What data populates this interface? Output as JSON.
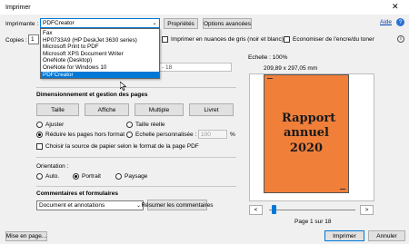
{
  "window": {
    "title": "Imprimer",
    "close_glyph": "✕"
  },
  "help": {
    "label": "Aide",
    "icon": "help-icon"
  },
  "printer": {
    "label": "Imprimante :",
    "selected": "PDFCreator",
    "properties_button": "Propriétés",
    "advanced_button": "Options avancées",
    "options": [
      "Fax",
      "HP0733A9 (HP DeskJet 3630 series)",
      "Microsoft Print to PDF",
      "Microsoft XPS Document Writer",
      "OneNote (Desktop)",
      "OneNote for Windows 10",
      "PDFCreator"
    ],
    "highlighted": "PDFCreator"
  },
  "copies": {
    "label": "Copies :",
    "value": "1"
  },
  "options": {
    "grayscale": "Imprimer en nuances de gris (noir et blanc)",
    "save_ink": "Economiser de l'encre/du toner"
  },
  "pages_partial": {
    "value_fragment": "- 18"
  },
  "sizing": {
    "title": "Dimensionnement et gestion des pages",
    "buttons": [
      "Taille",
      "Affiche",
      "Multiple",
      "Livret"
    ],
    "fit": "Ajuster",
    "actual_size": "Taille réelle",
    "shrink": "Réduire les pages hors format",
    "custom_scale": "Echelle personnalisée :",
    "scale_value": "100",
    "scale_unit": "%",
    "paper_source": "Choisir la source de papier selon le format de la page PDF"
  },
  "orientation": {
    "title": "Orientation :",
    "auto": "Auto.",
    "portrait": "Portrait",
    "landscape": "Paysage"
  },
  "comments": {
    "title": "Commentaires et formulaires",
    "selected": "Document et annotations",
    "summarize_button": "Résumer les commentaires"
  },
  "preview": {
    "scale": "Echelle : 100%",
    "dimensions": "209,89 x 297,05 mm",
    "page_title": "Rapport annuel 2020",
    "page_info": "Page 1 sur 18",
    "page_color": "#f07f3a",
    "prev": "<",
    "next": ">"
  },
  "footer": {
    "setup_button": "Mise en page...",
    "print_button": "Imprimer",
    "cancel_button": "Annuler"
  }
}
